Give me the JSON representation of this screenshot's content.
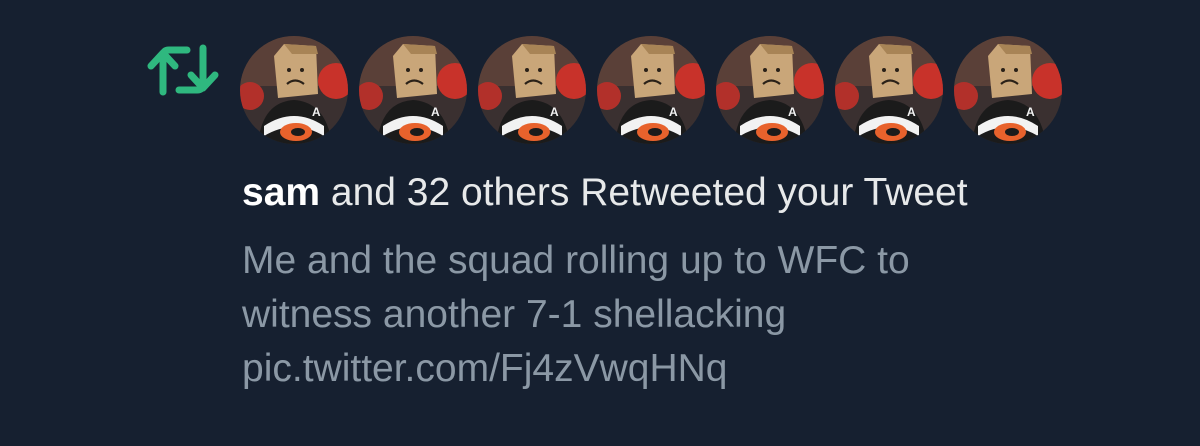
{
  "notification": {
    "icon": "retweet-icon",
    "accent_color": "#00ba7c",
    "user": "sam",
    "action_text": " and 32 others Retweeted your Tweet",
    "tweet_text": "Me and the squad rolling up to WFC to\nwitness another 7-1 shellacking",
    "tweet_link": "pic.twitter.com/Fj4zVwqHNq",
    "avatar_count": 7
  }
}
